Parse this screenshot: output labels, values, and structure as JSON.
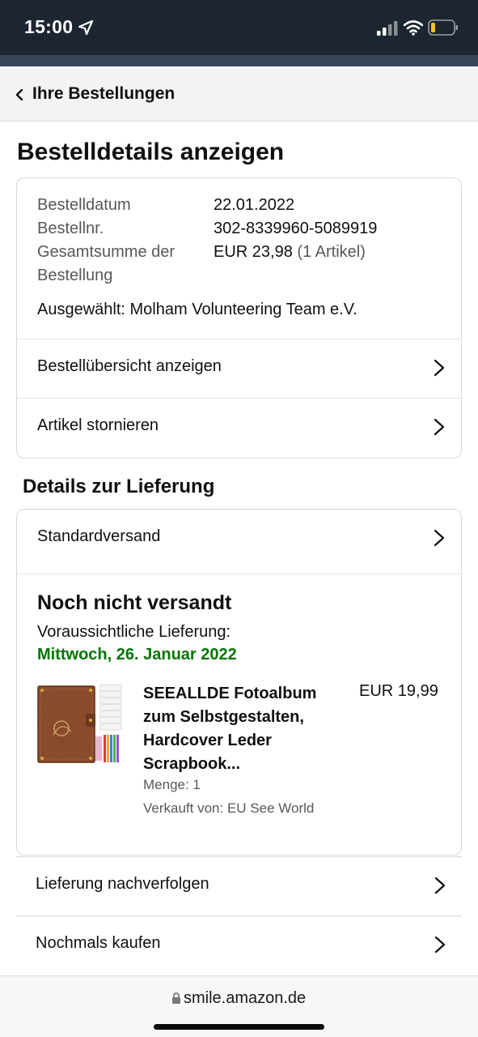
{
  "status_bar": {
    "time": "15:00"
  },
  "header": {
    "back_label": "Ihre Bestellungen"
  },
  "page_title": "Bestelldetails anzeigen",
  "order_info": {
    "date_label": "Bestelldatum",
    "date_value": "22.01.2022",
    "number_label": "Bestellnr.",
    "number_value": "302-8339960-5089919",
    "total_label_line1": "Gesamtsumme der",
    "total_label_line2": "Bestellung",
    "total_value": "EUR 23,98",
    "total_items": "(1 Artikel)",
    "selected": "Ausgewählt: Molham Volunteering Team e.V.",
    "summary_link": "Bestellübersicht anzeigen",
    "cancel_link": "Artikel stornieren"
  },
  "delivery": {
    "section_title": "Details zur Lieferung",
    "shipping_method": "Standardversand",
    "status": "Noch nicht versandt",
    "expected_label": "Voraussichtliche Lieferung:",
    "expected_date": "Mittwoch, 26. Januar 2022",
    "accent_color": "#007600"
  },
  "product": {
    "title_line1": "SEEALLDE Fotoalbum",
    "title_line2": "zum Selbstgestalten,",
    "title_line3": "Hardcover Leder",
    "title_line4": "Scrapbook...",
    "price": "EUR 19,99",
    "quantity": "Menge: 1",
    "seller": "Verkauft von: EU See World",
    "image_icon": "photo-album-thumbnail"
  },
  "actions": {
    "track": "Lieferung nachverfolgen",
    "buy_again": "Nochmals kaufen"
  },
  "browser": {
    "url": "smile.amazon.de"
  }
}
